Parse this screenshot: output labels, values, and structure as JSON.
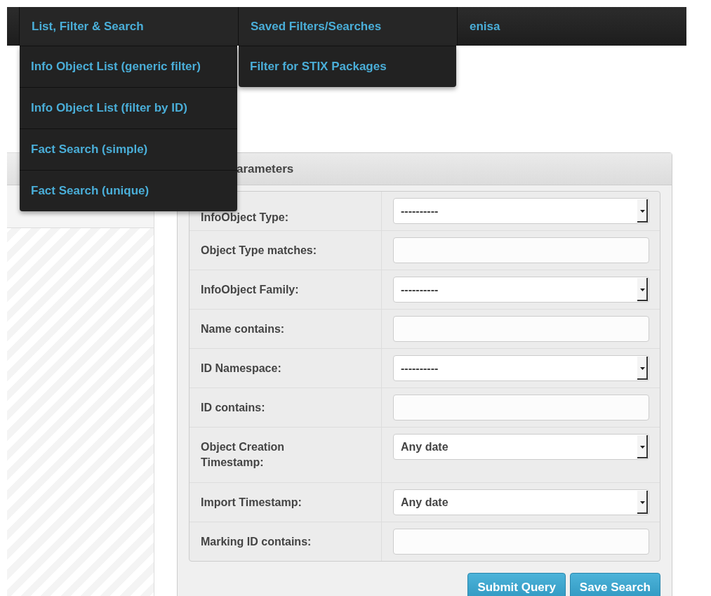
{
  "navbar": {
    "items": [
      {
        "label": "List, Filter & Search",
        "expanded": true,
        "menu": [
          "Info Object List (generic filter)",
          "Info Object List (filter by ID)",
          "Fact Search (simple)",
          "Fact Search (unique)"
        ]
      },
      {
        "label": "Saved Filters/Searches",
        "expanded": true,
        "menu": [
          "Filter for STIX Packages"
        ]
      },
      {
        "label": "enisa",
        "expanded": false
      }
    ]
  },
  "panel": {
    "title": "arameters",
    "fields": [
      {
        "label": "InfoObject Type:",
        "kind": "select",
        "value": "----------"
      },
      {
        "label": "Object Type matches:",
        "kind": "text"
      },
      {
        "label": "InfoObject Family:",
        "kind": "select",
        "value": "----------"
      },
      {
        "label": "Name contains:",
        "kind": "text"
      },
      {
        "label": "ID Namespace:",
        "kind": "select",
        "value": "----------"
      },
      {
        "label": "ID contains:",
        "kind": "text"
      },
      {
        "label": "Object Creation Timestamp:",
        "kind": "select",
        "value": "Any date"
      },
      {
        "label": "Import Timestamp:",
        "kind": "select",
        "value": "Any date"
      },
      {
        "label": "Marking ID contains:",
        "kind": "text"
      }
    ],
    "buttons": [
      "Submit Query",
      "Save Search"
    ]
  }
}
